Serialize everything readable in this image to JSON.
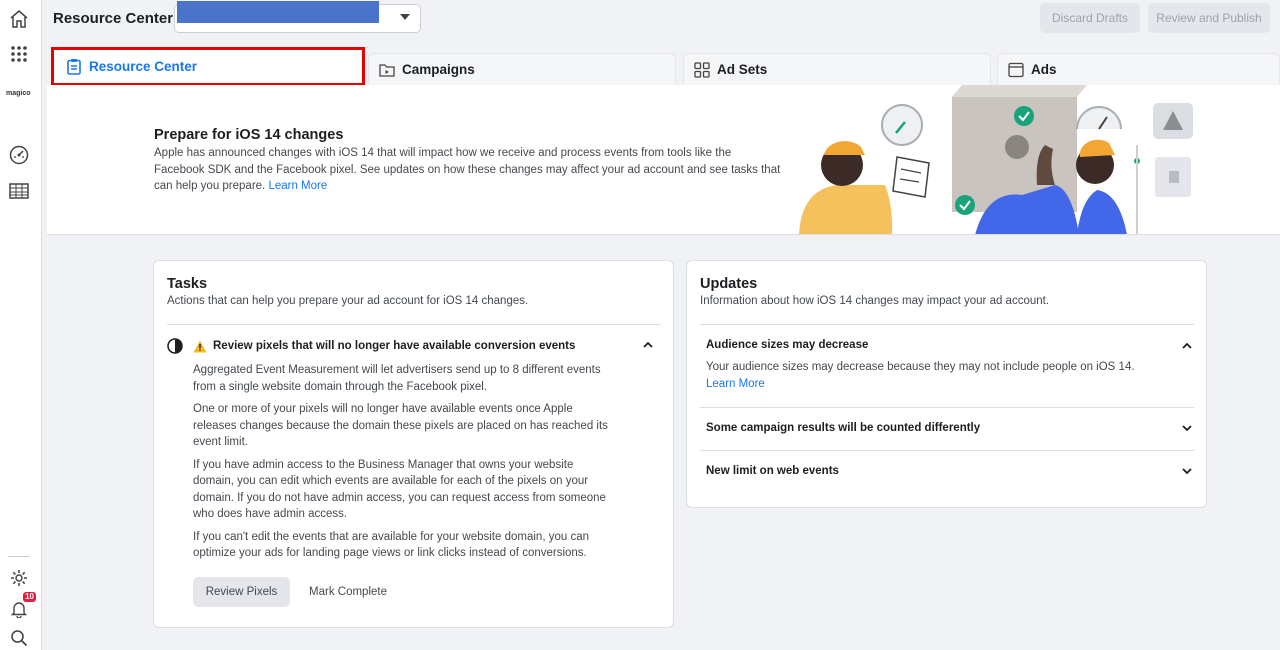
{
  "rail": {
    "icons": [
      "home-icon",
      "apps-grid-icon",
      "gauge-icon",
      "table-icon",
      "gear-icon",
      "bell-icon",
      "search-icon"
    ],
    "logo": "magico",
    "notifications_count": "10"
  },
  "topbar": {
    "title": "Resource Center",
    "discard_label": "Discard Drafts",
    "publish_label": "Review and Publish"
  },
  "tabs": [
    {
      "label": "Resource Center",
      "icon": "clipboard-icon",
      "active": true
    },
    {
      "label": "Campaigns",
      "icon": "folder-icon",
      "active": false
    },
    {
      "label": "Ad Sets",
      "icon": "grid-icon",
      "active": false
    },
    {
      "label": "Ads",
      "icon": "window-icon",
      "active": false
    }
  ],
  "banner": {
    "title": "Prepare for iOS 14 changes",
    "text": "Apple has announced changes with iOS 14 that will impact how we receive and process events from tools like the Facebook SDK and the Facebook pixel. See updates on how these changes may affect your ad account and see tasks that can help you prepare.",
    "link": "Learn More"
  },
  "tasks": {
    "title": "Tasks",
    "subtitle": "Actions that can help you prepare your ad account for iOS 14 changes.",
    "item": {
      "title": "Review pixels that will no longer have available conversion events",
      "paragraphs": [
        "Aggregated Event Measurement will let advertisers send up to 8 different events from a single website domain through the Facebook pixel.",
        "One or more of your pixels will no longer have available events once Apple releases changes because the domain these pixels are placed on has reached its event limit.",
        "If you have admin access to the Business Manager that owns your website domain, you can edit which events are available for each of the pixels on your domain. If you do not have admin access, you can request access from someone who does have admin access.",
        "If you can't edit the events that are available for your website domain, you can optimize your ads for landing page views or link clicks instead of conversions."
      ],
      "review_button": "Review Pixels",
      "complete_button": "Mark Complete"
    }
  },
  "updates": {
    "title": "Updates",
    "subtitle": "Information about how iOS 14 changes may impact your ad account.",
    "items": [
      {
        "title": "Audience sizes may decrease",
        "text": "Your audience sizes may decrease because they may not include people on iOS 14.",
        "link": "Learn More",
        "expanded": true
      },
      {
        "title": "Some campaign results will be counted differently",
        "expanded": false
      },
      {
        "title": "New limit on web events",
        "expanded": false
      }
    ]
  },
  "colors": {
    "accent": "#1877f2",
    "highlight_border": "#e60000",
    "warning": "#f7b928",
    "background": "#f0f2f5"
  }
}
